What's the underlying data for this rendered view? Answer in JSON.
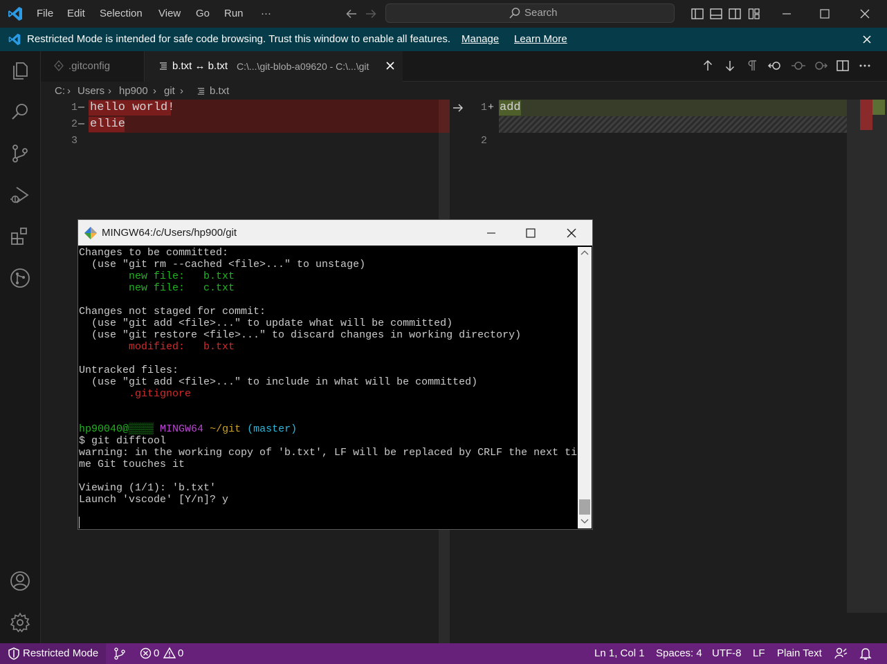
{
  "menu": [
    "File",
    "Edit",
    "Selection",
    "View",
    "Go",
    "Run",
    "···"
  ],
  "search": {
    "label": "Search"
  },
  "banner": {
    "text": "Restricted Mode is intended for safe code browsing. Trust this window to enable all features.",
    "manage": "Manage",
    "learn_more": "Learn More"
  },
  "tabs": [
    {
      "label": ".gitconfig"
    },
    {
      "label": "b.txt ↔ b.txt",
      "description": "C:\\...\\git-blob-a09620 - C:\\...\\git"
    }
  ],
  "breadcrumb": [
    "C:",
    "Users",
    "hp900",
    "git",
    "b.txt"
  ],
  "diff": {
    "left": [
      {
        "num": "1",
        "marker": "—",
        "text": "hello world!"
      },
      {
        "num": "2",
        "marker": "—",
        "text": "ellie"
      },
      {
        "num": "3",
        "marker": "",
        "text": ""
      }
    ],
    "right": [
      {
        "num": "1",
        "marker": "+",
        "text": "add"
      },
      {
        "num": "2",
        "marker": "",
        "text": ""
      }
    ]
  },
  "terminal": {
    "title": "MINGW64:/c/Users/hp900/git",
    "lines": [
      {
        "text": "Changes to be committed:"
      },
      {
        "text": "  (use \"git rm --cached <file>...\" to unstage)"
      },
      {
        "text": "        new file:   b.txt",
        "color": "#1fb61f"
      },
      {
        "text": "        new file:   c.txt",
        "color": "#1fb61f"
      },
      {
        "text": ""
      },
      {
        "text": "Changes not staged for commit:"
      },
      {
        "text": "  (use \"git add <file>...\" to update what will be committed)"
      },
      {
        "text": "  (use \"git restore <file>...\" to discard changes in working directory)"
      },
      {
        "text": "        modified:   b.txt",
        "color": "#d12b2b"
      },
      {
        "text": ""
      },
      {
        "text": "Untracked files:"
      },
      {
        "text": "  (use \"git add <file>...\" to include in what will be committed)"
      },
      {
        "text": "        .gitignore",
        "color": "#d12b2b"
      },
      {
        "text": ""
      },
      {
        "text": ""
      },
      {
        "parts": [
          {
            "text": "hp90040@",
            "color": "#1fb61f"
          },
          {
            "text": "▒▒▒▒",
            "color": "#1fb61f"
          },
          {
            "text": " "
          },
          {
            "text": "MINGW64",
            "color": "#b848d0"
          },
          {
            "text": " "
          },
          {
            "text": "~/git",
            "color": "#c9a227"
          },
          {
            "text": " "
          },
          {
            "text": "(master)",
            "color": "#29b8db"
          }
        ]
      },
      {
        "text": "$ git difftool"
      },
      {
        "text": "warning: in the working copy of 'b.txt', LF will be replaced by CRLF the next ti"
      },
      {
        "text": "me Git touches it"
      },
      {
        "text": ""
      },
      {
        "text": "Viewing (1/1): 'b.txt'"
      },
      {
        "text": "Launch 'vscode' [Y/n]? y"
      }
    ]
  },
  "status": {
    "restricted": "Restricted Mode",
    "errors": "0",
    "warnings": "0",
    "position": "Ln 1, Col 1",
    "spaces": "Spaces: 4",
    "encoding": "UTF-8",
    "eol": "LF",
    "language": "Plain Text"
  },
  "colors": {
    "status_bar": "#68217a",
    "banner": "#063b49",
    "removed_line": "#4b1818",
    "removed_text": "#7a1d1d",
    "inserted_line": "#373d29",
    "inserted_text": "#4f5f2c",
    "accent": "#0078d4"
  }
}
